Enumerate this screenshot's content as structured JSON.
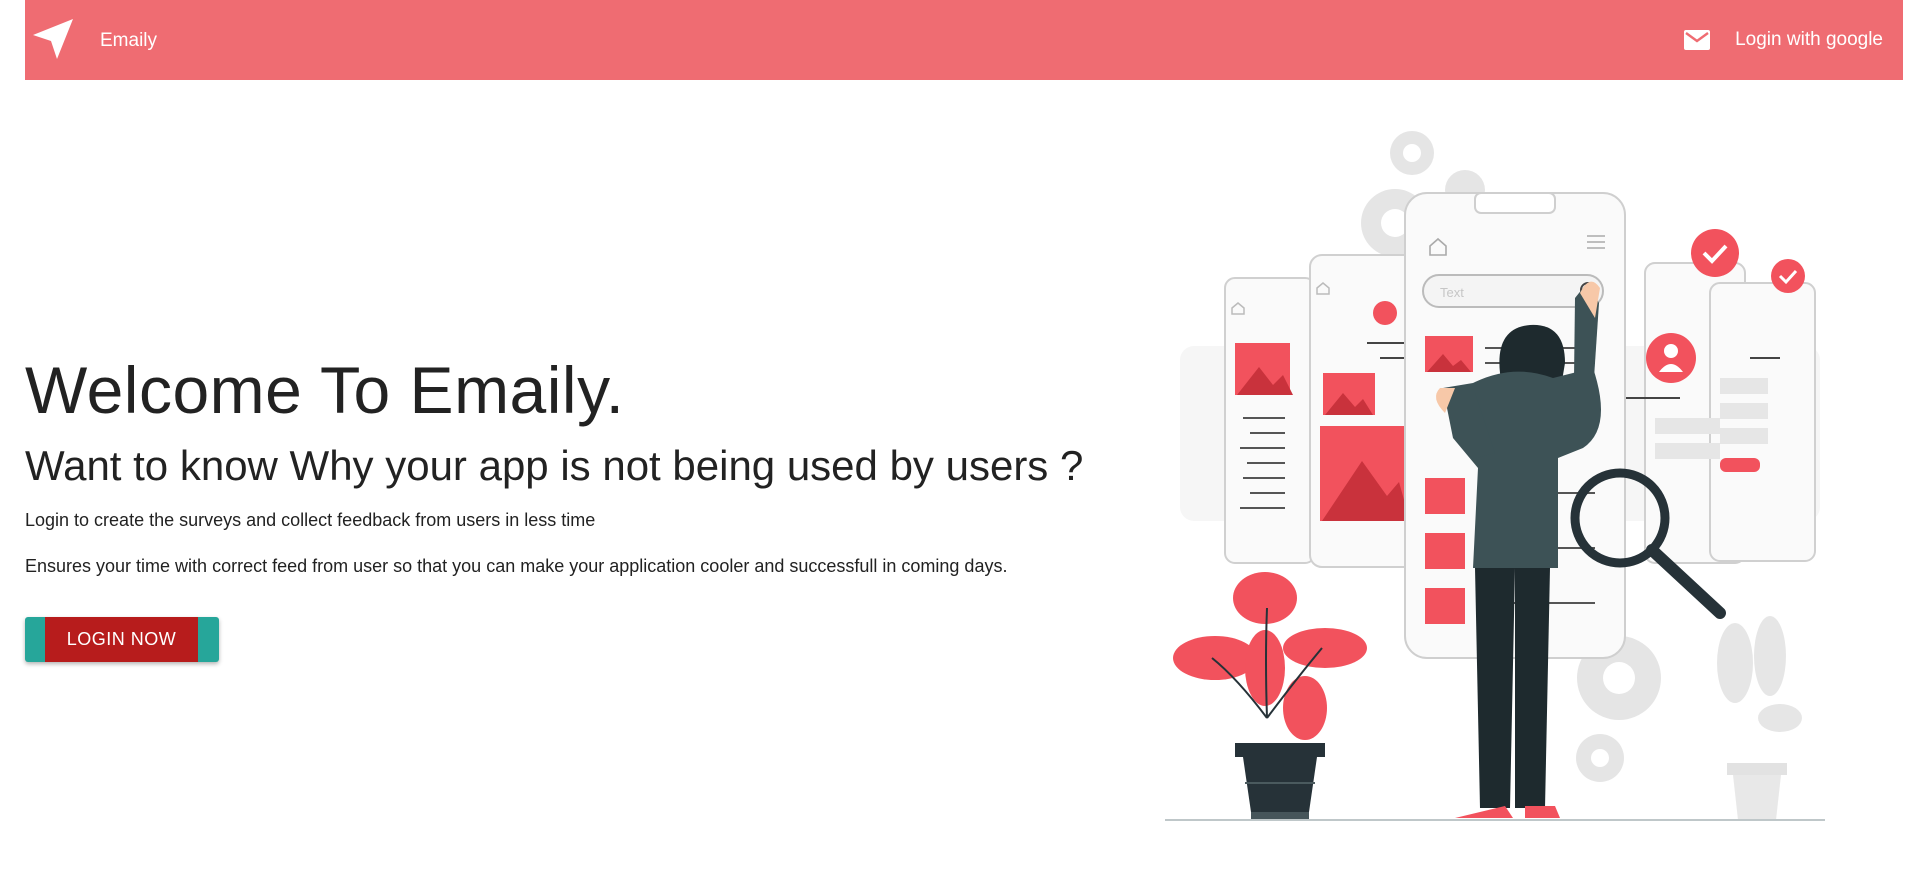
{
  "navbar": {
    "brand_icon": "paper-plane-icon",
    "brand_name": "Emaily",
    "login_icon": "mail-icon",
    "login_label": "Login with google",
    "background": "#ef6c72"
  },
  "hero": {
    "title": "Welcome To Emaily.",
    "subtitle": "Want to know Why your app is not being used by users ?",
    "line1": "Login to create the surveys and collect feedback from users in less time",
    "line2": "Ensures your time with correct feed from user so that you can make your application cooler and successfull in coming days.",
    "cta_label": "LOGIN NOW",
    "cta_colors": {
      "outer": "#26a69a",
      "inner": "#b71c1c"
    }
  },
  "illustration": {
    "search_placeholder": "Text",
    "accent": "#f2525d",
    "dark": "#263238"
  }
}
